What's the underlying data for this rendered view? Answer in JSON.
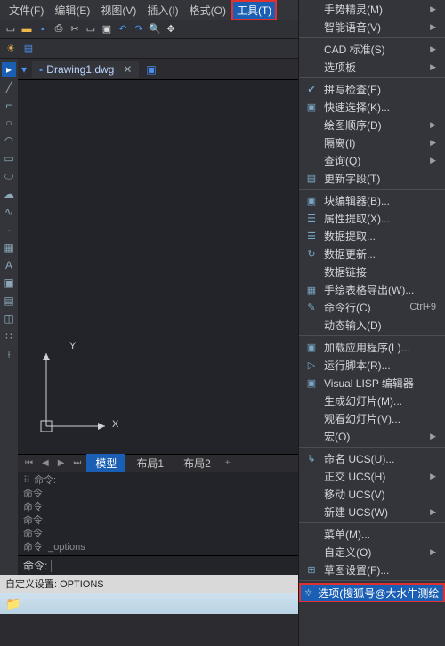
{
  "menubar": {
    "items": [
      {
        "label": "文件(F)"
      },
      {
        "label": "编辑(E)"
      },
      {
        "label": "视图(V)"
      },
      {
        "label": "插入(I)"
      },
      {
        "label": "格式(O)"
      },
      {
        "label": "工具(T)",
        "active": true
      }
    ]
  },
  "file_tab": {
    "name": "Drawing1.dwg",
    "icon": "dwg-icon"
  },
  "model_tabs": {
    "tabs": [
      "模型",
      "布局1",
      "布局2"
    ],
    "active": 0
  },
  "axes": {
    "x": "X",
    "y": "Y"
  },
  "command_history": [
    "命令:",
    "命令:",
    "命令:",
    "命令:",
    "命令:",
    "命令: _options"
  ],
  "cmd_prompt": "命令:",
  "statusbar_text": "自定义设置: OPTIONS",
  "dropdown": {
    "groups": [
      [
        {
          "label": "手势精灵(M)",
          "submenu": true
        },
        {
          "label": "智能语音(V)",
          "submenu": true
        }
      ],
      [
        {
          "label": "CAD 标准(S)",
          "submenu": true
        },
        {
          "label": "选项板",
          "submenu": true
        }
      ],
      [
        {
          "label": "拼写检查(E)",
          "icon": "✔"
        },
        {
          "label": "快速选择(K)...",
          "icon": "▣"
        },
        {
          "label": "绘图顺序(D)",
          "submenu": true
        },
        {
          "label": "隔离(I)",
          "submenu": true
        },
        {
          "label": "查询(Q)",
          "submenu": true
        },
        {
          "label": "更新字段(T)",
          "icon": "▤"
        }
      ],
      [
        {
          "label": "块编辑器(B)...",
          "icon": "▣"
        },
        {
          "label": "属性提取(X)...",
          "icon": "☰"
        },
        {
          "label": "数据提取...",
          "icon": "☰"
        },
        {
          "label": "数据更新...",
          "icon": "↻"
        },
        {
          "label": "数据链接"
        },
        {
          "label": "手绘表格导出(W)...",
          "icon": "▦"
        },
        {
          "label": "命令行(C)",
          "icon": "✎",
          "shortcut": "Ctrl+9"
        },
        {
          "label": "动态输入(D)"
        }
      ],
      [
        {
          "label": "加载应用程序(L)...",
          "icon": "▣"
        },
        {
          "label": "运行脚本(R)...",
          "icon": "▷"
        },
        {
          "label": "Visual LISP 编辑器",
          "icon": "▣"
        },
        {
          "label": "生成幻灯片(M)..."
        },
        {
          "label": "观看幻灯片(V)..."
        },
        {
          "label": "宏(O)",
          "submenu": true
        }
      ],
      [
        {
          "label": "命名 UCS(U)...",
          "icon": "↳"
        },
        {
          "label": "正交 UCS(H)",
          "submenu": true
        },
        {
          "label": "移动 UCS(V)"
        },
        {
          "label": "新建 UCS(W)",
          "submenu": true
        }
      ],
      [
        {
          "label": "菜单(M)..."
        },
        {
          "label": "自定义(O)",
          "submenu": true
        },
        {
          "label": "草图设置(F)...",
          "icon": "⊞"
        }
      ],
      [
        {
          "label": "选项(搜狐号@大水牛测绘",
          "icon": "✲",
          "highlight": true
        }
      ]
    ]
  }
}
